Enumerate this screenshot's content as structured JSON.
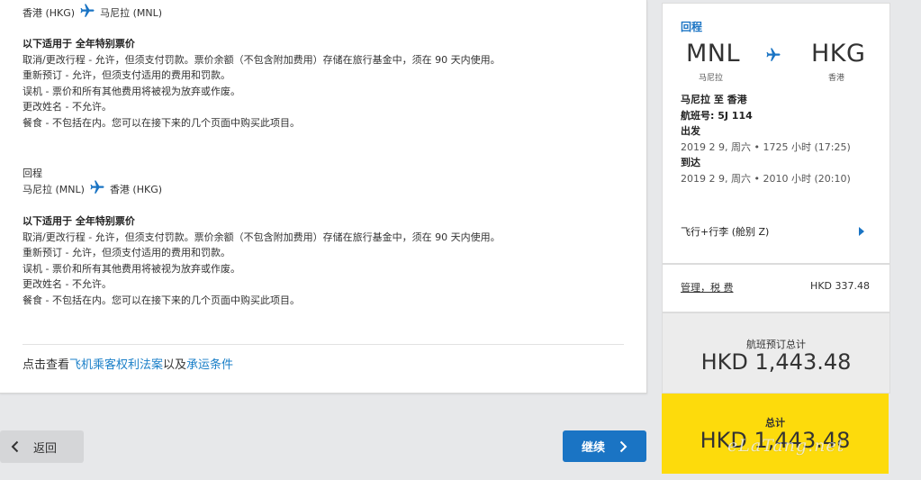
{
  "outbound": {
    "origin": "香港 (HKG)",
    "destination": "马尼拉 (MNL)",
    "rules_heading": "以下适用于 全年特别票价",
    "rules": [
      "取消/更改行程 - 允许，但须支付罚款。票价余额（不包含附加费用）存储在旅行基金中，须在 90 天内使用。",
      "重新预订 - 允许，但须支付适用的费用和罚款。",
      "误机 - 票价和所有其他费用将被视为放弃或作废。",
      "更改姓名 - 不允许。",
      "餐食 - 不包括在内。您可以在接下来的几个页面中购买此项目。"
    ]
  },
  "return": {
    "title": "回程",
    "origin": "马尼拉 (MNL)",
    "destination": "香港 (HKG)",
    "rules_heading": "以下适用于 全年特别票价",
    "rules": [
      "取消/更改行程 - 允许，但须支付罚款。票价余额（不包含附加费用）存储在旅行基金中，须在 90 天内使用。",
      "重新预订 - 允许，但须支付适用的费用和罚款。",
      "误机 - 票价和所有其他费用将被视为放弃或作废。",
      "更改姓名 - 不允许。",
      "餐食 - 不包括在内。您可以在接下来的几个页面中购买此项目。"
    ]
  },
  "legal": {
    "prefix": "点击查看",
    "link1": "飞机乘客权利法案",
    "middle": "以及",
    "link2": "承运条件"
  },
  "buttons": {
    "back": "返回",
    "continue": "继续"
  },
  "summary": {
    "leg_title": "回程",
    "from_code": "MNL",
    "from_city": "马尼拉",
    "to_code": "HKG",
    "to_city": "香港",
    "route": "马尼拉 至 香港",
    "flight_no": "航班号: 5J 114",
    "depart_label": "出发",
    "depart_time": "2019 2 9, 周六 • 1725 小时 (17:25)",
    "arrive_label": "到达",
    "arrive_time": "2019 2 9, 周六 • 2010 小时 (20:10)",
    "fare_type": "飞行+行李 (舱别 Z)",
    "fees_label": "管理，税 费",
    "fees_amount": "HKD 337.48",
    "subtotal_label": "航班预订总计",
    "subtotal_amount": "HKD 1,443.48",
    "total_label": "总计",
    "total_amount": "HKD 1,443.48"
  },
  "watermark": "eLaTang.net",
  "colors": {
    "accent": "#1a74c4",
    "link": "#1a7fc8",
    "total_bg": "#fddb0c"
  },
  "icons": {
    "plane": "airplane-icon",
    "back": "chevron-left-icon",
    "continue": "chevron-right-icon",
    "fare_expand": "triangle-right-icon"
  }
}
